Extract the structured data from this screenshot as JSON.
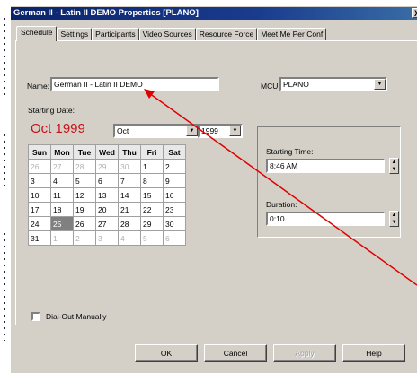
{
  "window": {
    "title": "German II - Latin II DEMO Properties  [PLANO]",
    "close_glyph": "X"
  },
  "tabs": [
    {
      "label": "Schedule"
    },
    {
      "label": "Settings"
    },
    {
      "label": "Participants"
    },
    {
      "label": "Video Sources"
    },
    {
      "label": "Resource Force"
    },
    {
      "label": "Meet Me Per Conf"
    }
  ],
  "form": {
    "name_label": "Name:",
    "name_value": "German II - Latin II DEMO",
    "mcu_label": "MCU:",
    "mcu_value": "PLANO",
    "starting_date_label": "Starting Date:",
    "big_month": "Oct 1999",
    "month_value": "Oct",
    "year_value": "1999"
  },
  "calendar": {
    "headers": [
      "Sun",
      "Mon",
      "Tue",
      "Wed",
      "Thu",
      "Fri",
      "Sat"
    ],
    "rows": [
      [
        "26",
        "27",
        "28",
        "29",
        "30",
        "1",
        "2"
      ],
      [
        "3",
        "4",
        "5",
        "6",
        "7",
        "8",
        "9"
      ],
      [
        "10",
        "11",
        "12",
        "13",
        "14",
        "15",
        "16"
      ],
      [
        "17",
        "18",
        "19",
        "20",
        "21",
        "22",
        "23"
      ],
      [
        "24",
        "25",
        "26",
        "27",
        "28",
        "29",
        "30"
      ],
      [
        "31",
        "1",
        "2",
        "3",
        "4",
        "5",
        "6"
      ]
    ],
    "selected": "25"
  },
  "time": {
    "starting_time_label": "Starting Time:",
    "starting_time_value": "8:46 AM",
    "duration_label": "Duration:",
    "duration_value": "0:10"
  },
  "dial_out_label": "Dial-Out Manually",
  "buttons": {
    "ok": "OK",
    "cancel": "Cancel",
    "apply": "Apply",
    "help": "Help"
  },
  "colors": {
    "title_bar": "#0a246a",
    "big_month": "#c8101a",
    "annotation_arrow": "#e00000"
  }
}
